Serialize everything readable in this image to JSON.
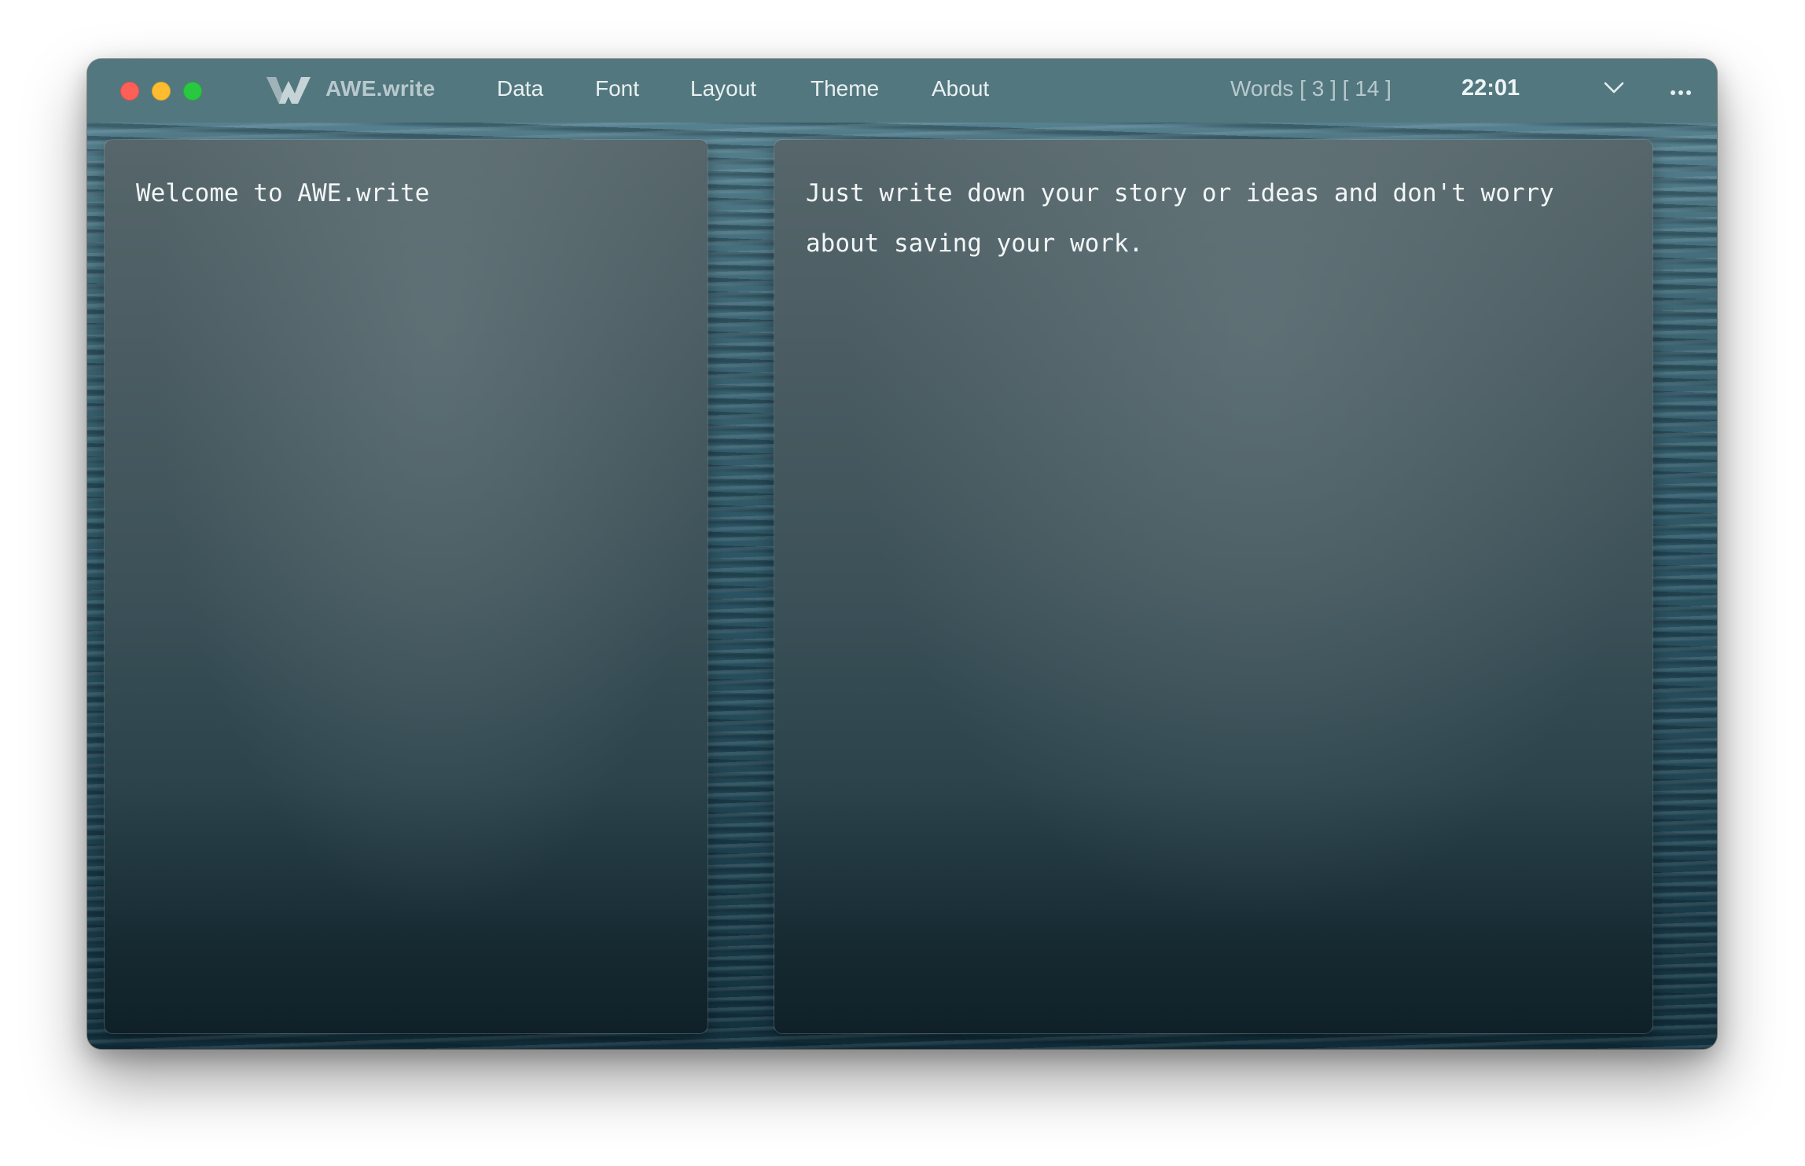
{
  "app": {
    "name": "AWE.write"
  },
  "menu": {
    "items": [
      {
        "label": "Data"
      },
      {
        "label": "Font"
      },
      {
        "label": "Layout"
      },
      {
        "label": "Theme"
      },
      {
        "label": "About"
      }
    ]
  },
  "status": {
    "words": "Words [ 3 ] [ 14 ]",
    "time": "22:01"
  },
  "editor": {
    "left_text": "Welcome to AWE.write",
    "right_text": "Just write down your story or ideas and don't worry about saving your work."
  },
  "icons": {
    "logo": "awe-logo-icon",
    "chevron": "chevron-down-icon",
    "more": "more-dots-icon"
  },
  "colors": {
    "titlebar": "#52777f",
    "close": "#fe5f57",
    "minimize": "#febc2e",
    "zoom": "#28c840"
  }
}
